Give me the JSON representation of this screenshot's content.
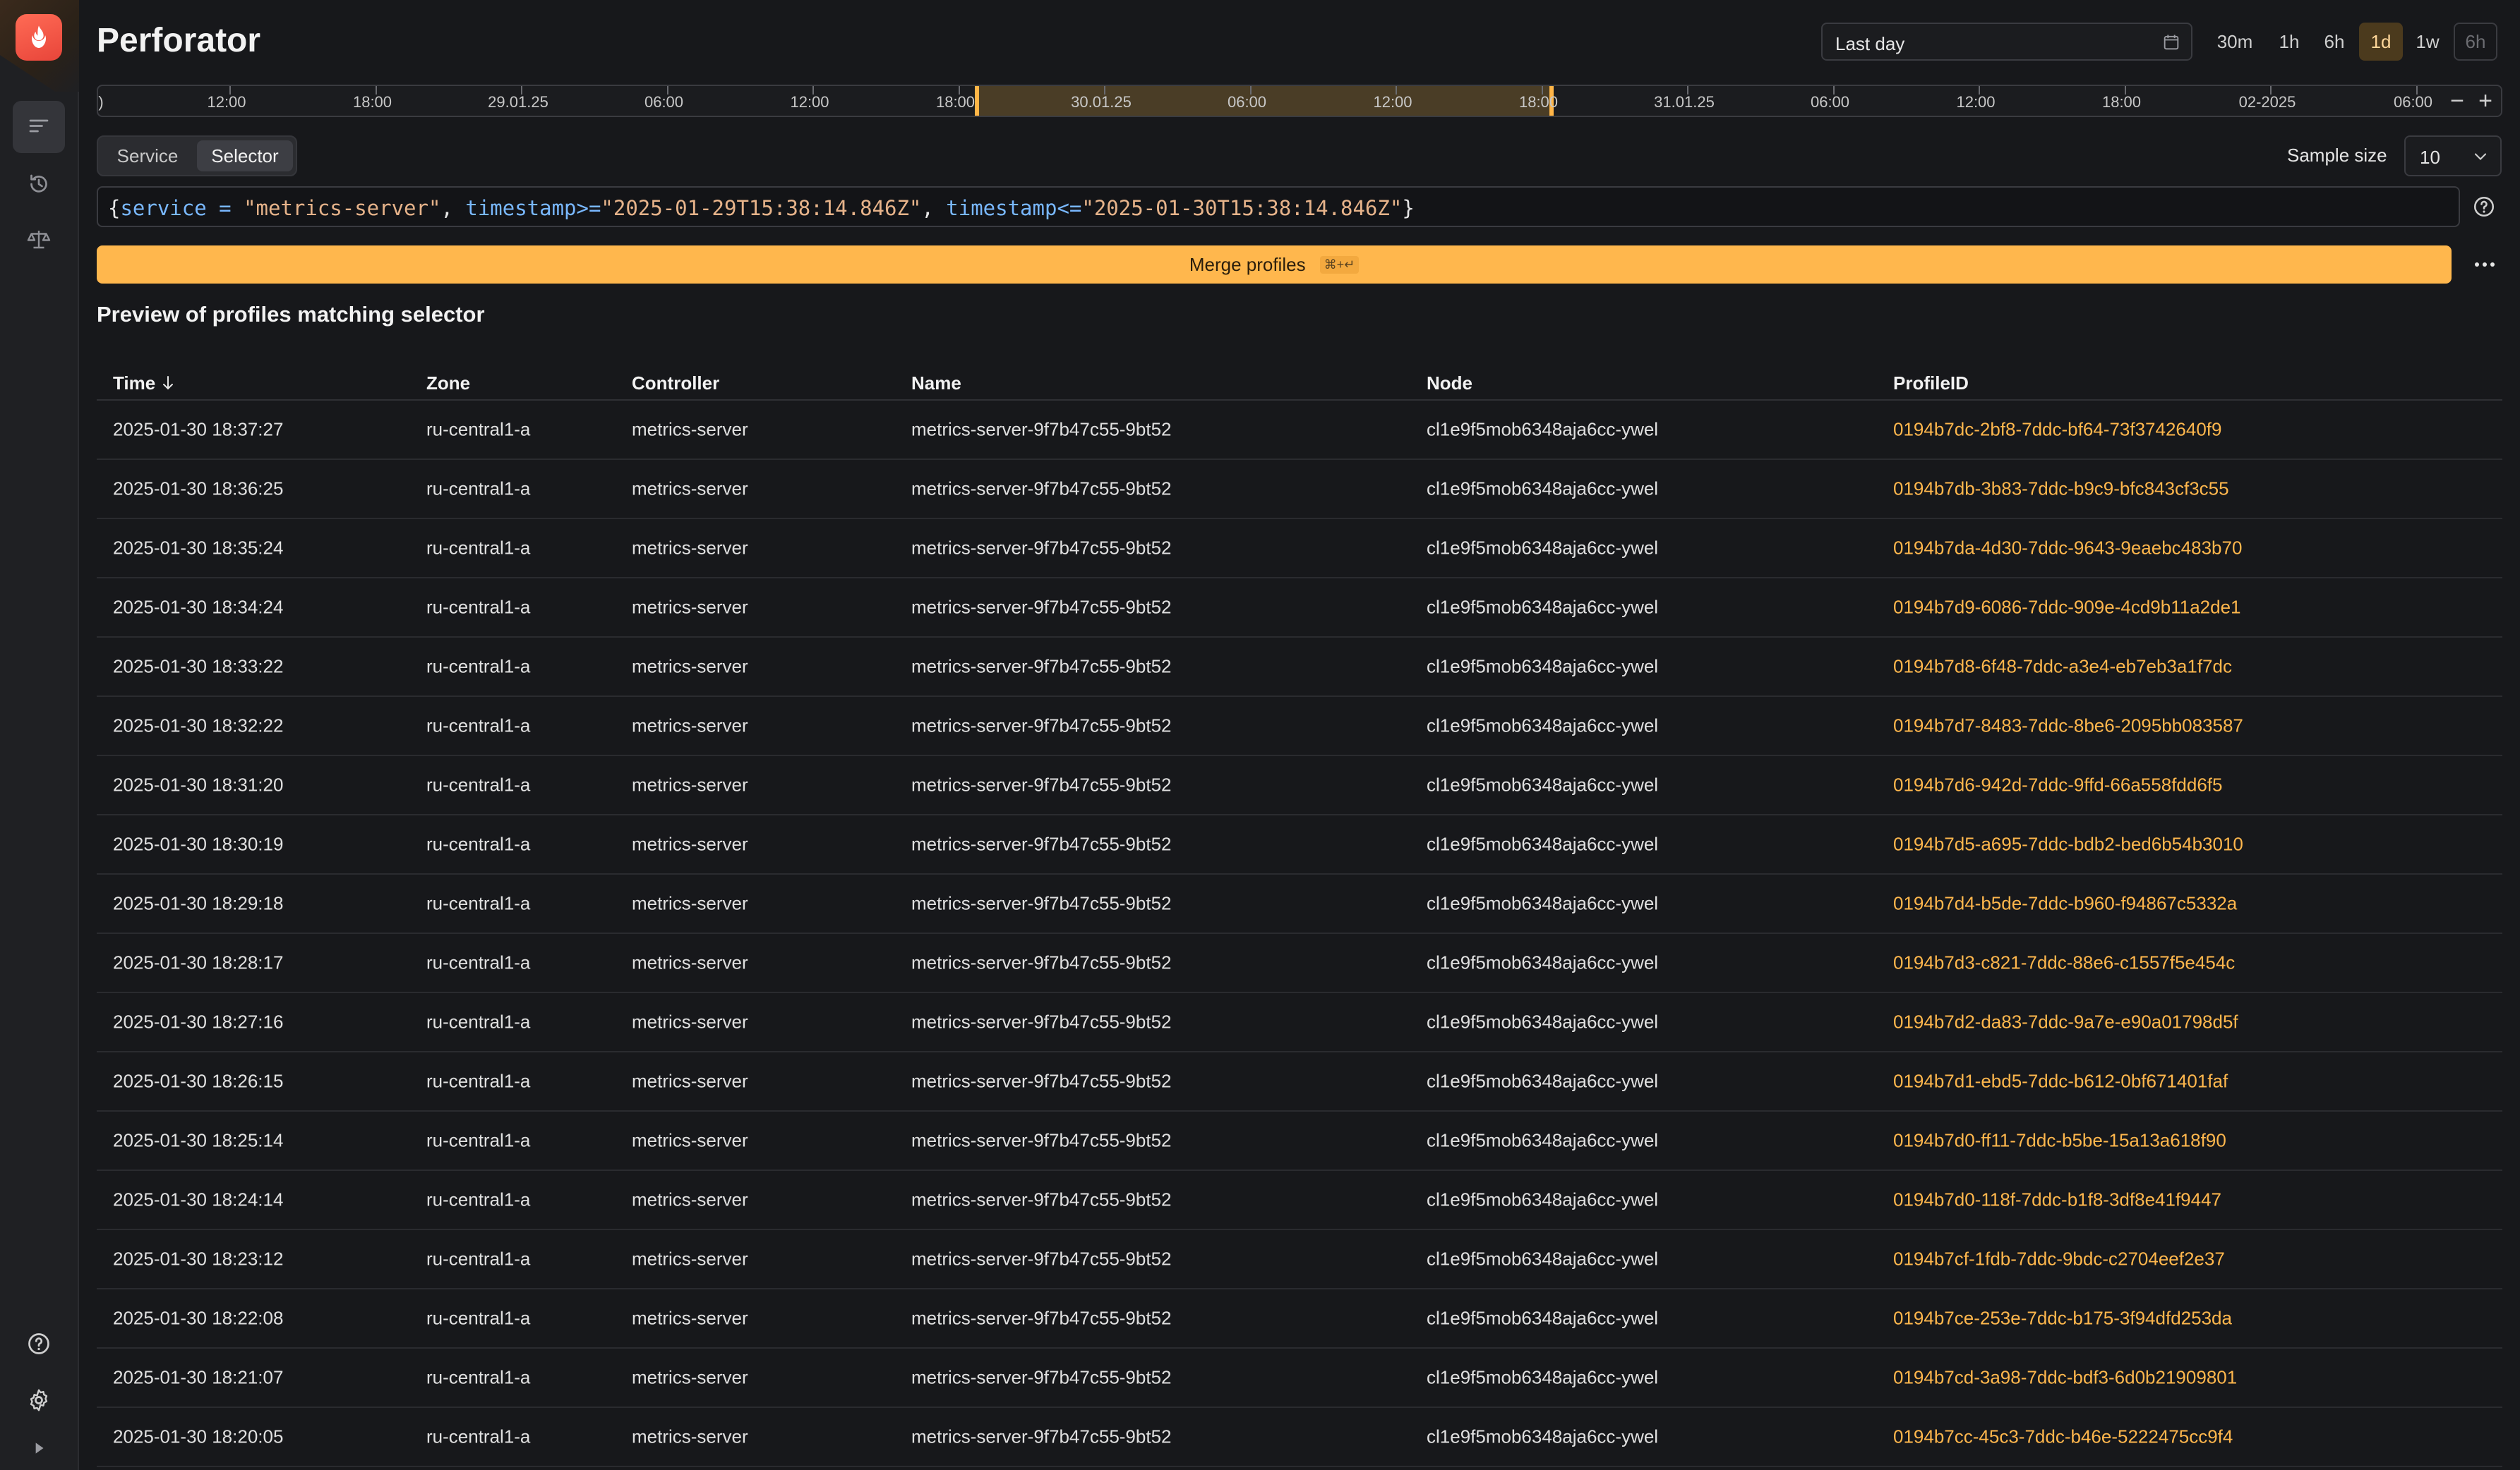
{
  "app": {
    "title": "Perforator"
  },
  "colors": {
    "accent": "#ffb74d",
    "background": "#17181b",
    "link": "#ffb74d"
  },
  "sidebar": {
    "items": [
      {
        "icon": "profiles-list-icon",
        "active": true
      },
      {
        "icon": "history-icon",
        "active": false
      },
      {
        "icon": "compare-scales-icon",
        "active": false
      }
    ],
    "bottom": [
      {
        "icon": "help-icon"
      },
      {
        "icon": "gear-icon"
      },
      {
        "icon": "expand-arrow-icon"
      }
    ]
  },
  "header": {
    "range_label": "Last day",
    "quick_ranges": [
      "30m",
      "1h",
      "6h",
      "1d",
      "1w",
      "6h"
    ],
    "selected_range": "1d"
  },
  "timeline": {
    "labels": [
      "12:00",
      "18:00",
      "29.01.25",
      "06:00",
      "12:00",
      "18:00",
      "30.01.25",
      "06:00",
      "12:00",
      "18:00",
      "31.01.25",
      "06:00",
      "12:00",
      "18:00",
      "02-2025",
      "06:00"
    ],
    "edge_label": ")",
    "zoom_out": "−",
    "zoom_in": "+"
  },
  "mode": {
    "options": [
      "Service",
      "Selector"
    ],
    "selected": "Selector"
  },
  "sample_size": {
    "label": "Sample size",
    "value": "10"
  },
  "selector": {
    "tokens": [
      {
        "t": "{",
        "k": "pun"
      },
      {
        "t": "service",
        "k": "key"
      },
      {
        "t": " = ",
        "k": "op"
      },
      {
        "t": "\"metrics-server\"",
        "k": "str"
      },
      {
        "t": ", ",
        "k": "pun"
      },
      {
        "t": "timestamp",
        "k": "key"
      },
      {
        "t": ">=",
        "k": "op"
      },
      {
        "t": "\"2025-01-29T15:38:14.846Z\"",
        "k": "str"
      },
      {
        "t": ", ",
        "k": "pun"
      },
      {
        "t": "timestamp",
        "k": "key"
      },
      {
        "t": "<=",
        "k": "op"
      },
      {
        "t": "\"2025-01-30T15:38:14.846Z\"",
        "k": "str"
      },
      {
        "t": "}",
        "k": "pun"
      }
    ]
  },
  "merge": {
    "label": "Merge profiles",
    "shortcut": "⌘+↵"
  },
  "preview": {
    "title": "Preview of profiles matching selector",
    "columns": [
      "Time",
      "Zone",
      "Controller",
      "Name",
      "Node",
      "ProfileID"
    ],
    "rows": [
      [
        "2025-01-30 18:37:27",
        "ru-central1-a",
        "metrics-server",
        "metrics-server-9f7b47c55-9bt52",
        "cl1e9f5mob6348aja6cc-ywel",
        "0194b7dc-2bf8-7ddc-bf64-73f3742640f9"
      ],
      [
        "2025-01-30 18:36:25",
        "ru-central1-a",
        "metrics-server",
        "metrics-server-9f7b47c55-9bt52",
        "cl1e9f5mob6348aja6cc-ywel",
        "0194b7db-3b83-7ddc-b9c9-bfc843cf3c55"
      ],
      [
        "2025-01-30 18:35:24",
        "ru-central1-a",
        "metrics-server",
        "metrics-server-9f7b47c55-9bt52",
        "cl1e9f5mob6348aja6cc-ywel",
        "0194b7da-4d30-7ddc-9643-9eaebc483b70"
      ],
      [
        "2025-01-30 18:34:24",
        "ru-central1-a",
        "metrics-server",
        "metrics-server-9f7b47c55-9bt52",
        "cl1e9f5mob6348aja6cc-ywel",
        "0194b7d9-6086-7ddc-909e-4cd9b11a2de1"
      ],
      [
        "2025-01-30 18:33:22",
        "ru-central1-a",
        "metrics-server",
        "metrics-server-9f7b47c55-9bt52",
        "cl1e9f5mob6348aja6cc-ywel",
        "0194b7d8-6f48-7ddc-a3e4-eb7eb3a1f7dc"
      ],
      [
        "2025-01-30 18:32:22",
        "ru-central1-a",
        "metrics-server",
        "metrics-server-9f7b47c55-9bt52",
        "cl1e9f5mob6348aja6cc-ywel",
        "0194b7d7-8483-7ddc-8be6-2095bb083587"
      ],
      [
        "2025-01-30 18:31:20",
        "ru-central1-a",
        "metrics-server",
        "metrics-server-9f7b47c55-9bt52",
        "cl1e9f5mob6348aja6cc-ywel",
        "0194b7d6-942d-7ddc-9ffd-66a558fdd6f5"
      ],
      [
        "2025-01-30 18:30:19",
        "ru-central1-a",
        "metrics-server",
        "metrics-server-9f7b47c55-9bt52",
        "cl1e9f5mob6348aja6cc-ywel",
        "0194b7d5-a695-7ddc-bdb2-bed6b54b3010"
      ],
      [
        "2025-01-30 18:29:18",
        "ru-central1-a",
        "metrics-server",
        "metrics-server-9f7b47c55-9bt52",
        "cl1e9f5mob6348aja6cc-ywel",
        "0194b7d4-b5de-7ddc-b960-f94867c5332a"
      ],
      [
        "2025-01-30 18:28:17",
        "ru-central1-a",
        "metrics-server",
        "metrics-server-9f7b47c55-9bt52",
        "cl1e9f5mob6348aja6cc-ywel",
        "0194b7d3-c821-7ddc-88e6-c1557f5e454c"
      ],
      [
        "2025-01-30 18:27:16",
        "ru-central1-a",
        "metrics-server",
        "metrics-server-9f7b47c55-9bt52",
        "cl1e9f5mob6348aja6cc-ywel",
        "0194b7d2-da83-7ddc-9a7e-e90a01798d5f"
      ],
      [
        "2025-01-30 18:26:15",
        "ru-central1-a",
        "metrics-server",
        "metrics-server-9f7b47c55-9bt52",
        "cl1e9f5mob6348aja6cc-ywel",
        "0194b7d1-ebd5-7ddc-b612-0bf671401faf"
      ],
      [
        "2025-01-30 18:25:14",
        "ru-central1-a",
        "metrics-server",
        "metrics-server-9f7b47c55-9bt52",
        "cl1e9f5mob6348aja6cc-ywel",
        "0194b7d0-ff11-7ddc-b5be-15a13a618f90"
      ],
      [
        "2025-01-30 18:24:14",
        "ru-central1-a",
        "metrics-server",
        "metrics-server-9f7b47c55-9bt52",
        "cl1e9f5mob6348aja6cc-ywel",
        "0194b7d0-118f-7ddc-b1f8-3df8e41f9447"
      ],
      [
        "2025-01-30 18:23:12",
        "ru-central1-a",
        "metrics-server",
        "metrics-server-9f7b47c55-9bt52",
        "cl1e9f5mob6348aja6cc-ywel",
        "0194b7cf-1fdb-7ddc-9bdc-c2704eef2e37"
      ],
      [
        "2025-01-30 18:22:08",
        "ru-central1-a",
        "metrics-server",
        "metrics-server-9f7b47c55-9bt52",
        "cl1e9f5mob6348aja6cc-ywel",
        "0194b7ce-253e-7ddc-b175-3f94dfd253da"
      ],
      [
        "2025-01-30 18:21:07",
        "ru-central1-a",
        "metrics-server",
        "metrics-server-9f7b47c55-9bt52",
        "cl1e9f5mob6348aja6cc-ywel",
        "0194b7cd-3a98-7ddc-bdf3-6d0b21909801"
      ],
      [
        "2025-01-30 18:20:05",
        "ru-central1-a",
        "metrics-server",
        "metrics-server-9f7b47c55-9bt52",
        "cl1e9f5mob6348aja6cc-ywel",
        "0194b7cc-45c3-7ddc-b46e-5222475cc9f4"
      ]
    ]
  }
}
